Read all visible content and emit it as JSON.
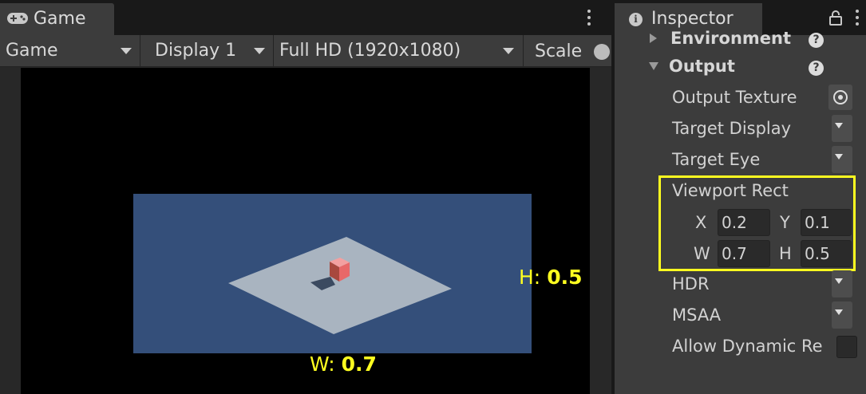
{
  "game_window": {
    "tab_title": "Game",
    "tab_icon": "gamepad-icon",
    "toolbar": {
      "mode_dropdown": "Game",
      "display_dropdown": "Display 1",
      "resolution_dropdown": "Full HD (1920x1080)",
      "scale_label": "Scale"
    },
    "overlay": {
      "height_prefix": "H:",
      "height_value": "0.5",
      "width_prefix": "W:",
      "width_value": "0.7"
    },
    "colors": {
      "viewport_background": "#000000",
      "camera_background": "#344f7a",
      "ground_plane": "#a9b4c0",
      "cube": "#e86868",
      "overlay_text": "#ffff20"
    }
  },
  "inspector": {
    "tab_title": "Inspector",
    "tab_icon": "info-icon",
    "sections": {
      "environment": "Environment",
      "output": "Output"
    },
    "properties": {
      "output_texture": "Output Texture",
      "target_display": "Target Display",
      "target_eye": "Target Eye",
      "viewport_rect": "Viewport Rect",
      "hdr": "HDR",
      "msaa": "MSAA",
      "allow_dynamic": "Allow Dynamic Re"
    },
    "viewport_rect": {
      "x_label": "X",
      "x_value": "0.2",
      "y_label": "Y",
      "y_value": "0.1",
      "w_label": "W",
      "w_value": "0.7",
      "h_label": "H",
      "h_value": "0.5"
    },
    "highlight_color": "#ffff20"
  }
}
